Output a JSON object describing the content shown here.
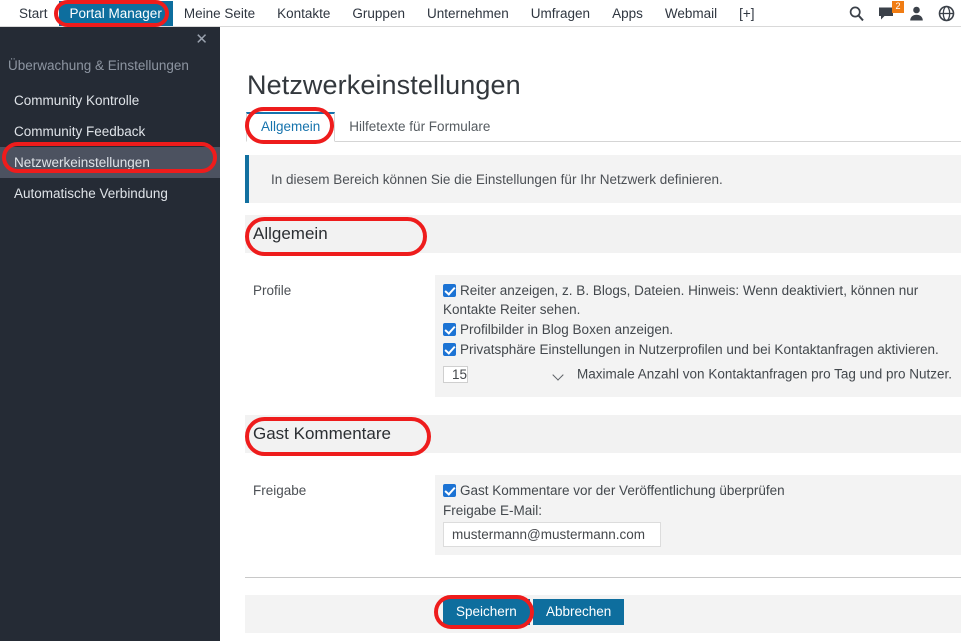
{
  "topnav": {
    "items": [
      {
        "label": "Start",
        "active": false
      },
      {
        "label": "Portal Manager",
        "active": true
      },
      {
        "label": "Meine Seite",
        "active": false
      },
      {
        "label": "Kontakte",
        "active": false
      },
      {
        "label": "Gruppen",
        "active": false
      },
      {
        "label": "Unternehmen",
        "active": false
      },
      {
        "label": "Umfragen",
        "active": false
      },
      {
        "label": "Apps",
        "active": false
      },
      {
        "label": "Webmail",
        "active": false
      },
      {
        "label": "[+]",
        "active": false
      }
    ],
    "icons": [
      "search-icon",
      "messages-icon",
      "user-icon",
      "globe-icon"
    ],
    "message_badge": "2",
    "badge_color": "#f07c13",
    "active_tab_color": "#0d6e9e"
  },
  "sidebar": {
    "close_label": "✕",
    "heading": "Überwachung & Einstellungen",
    "background": "#252b35",
    "selected_background": "#4c5260",
    "items": [
      {
        "label": "Community Kontrolle",
        "selected": false
      },
      {
        "label": "Community Feedback",
        "selected": false
      },
      {
        "label": "Netzwerkeinstellungen",
        "selected": true
      },
      {
        "label": "Automatische Verbindung",
        "selected": false
      }
    ]
  },
  "main": {
    "page_title": "Netzwerkeinstellungen",
    "tabs": [
      {
        "label": "Allgemein",
        "active": true
      },
      {
        "label": "Hilfetexte für Formulare",
        "active": false
      }
    ],
    "info_box": {
      "text": "In diesem Bereich können Sie die Einstellungen für Ihr Netzwerk definieren.",
      "accent_color": "#1270a0"
    },
    "sections": [
      {
        "title": "Allgemein",
        "row_label": "Profile",
        "checkboxes": [
          "Reiter anzeigen, z. B. Blogs, Dateien. Hinweis: Wenn deaktiviert, können nur Kontakte Reiter sehen.",
          "Profilbilder in Blog Boxen anzeigen.",
          "Privatsphäre Einstellungen in Nutzerprofilen und bei Kontaktanfragen aktivieren."
        ],
        "select_value": "15",
        "select_caption": "Maximale Anzahl von Kontaktanfragen pro Tag und pro Nutzer."
      },
      {
        "title": "Gast Kommentare",
        "row_label": "Freigabe",
        "checkbox": "Gast Kommentare vor der Veröffentlichung überprüfen",
        "email_label": "Freigabe E-Mail:",
        "email_value": "mustermann@mustermann.com"
      }
    ],
    "buttons": {
      "save_label": "Speichern",
      "cancel_label": "Abbrechen",
      "color": "#0e6e9e"
    }
  },
  "annotations": {
    "color": "#ee1c1c",
    "targets": [
      "Portal Manager",
      "Netzwerkeinstellungen",
      "Allgemein",
      "Allgemein",
      "Gast Kommentare",
      "Speichern"
    ]
  }
}
